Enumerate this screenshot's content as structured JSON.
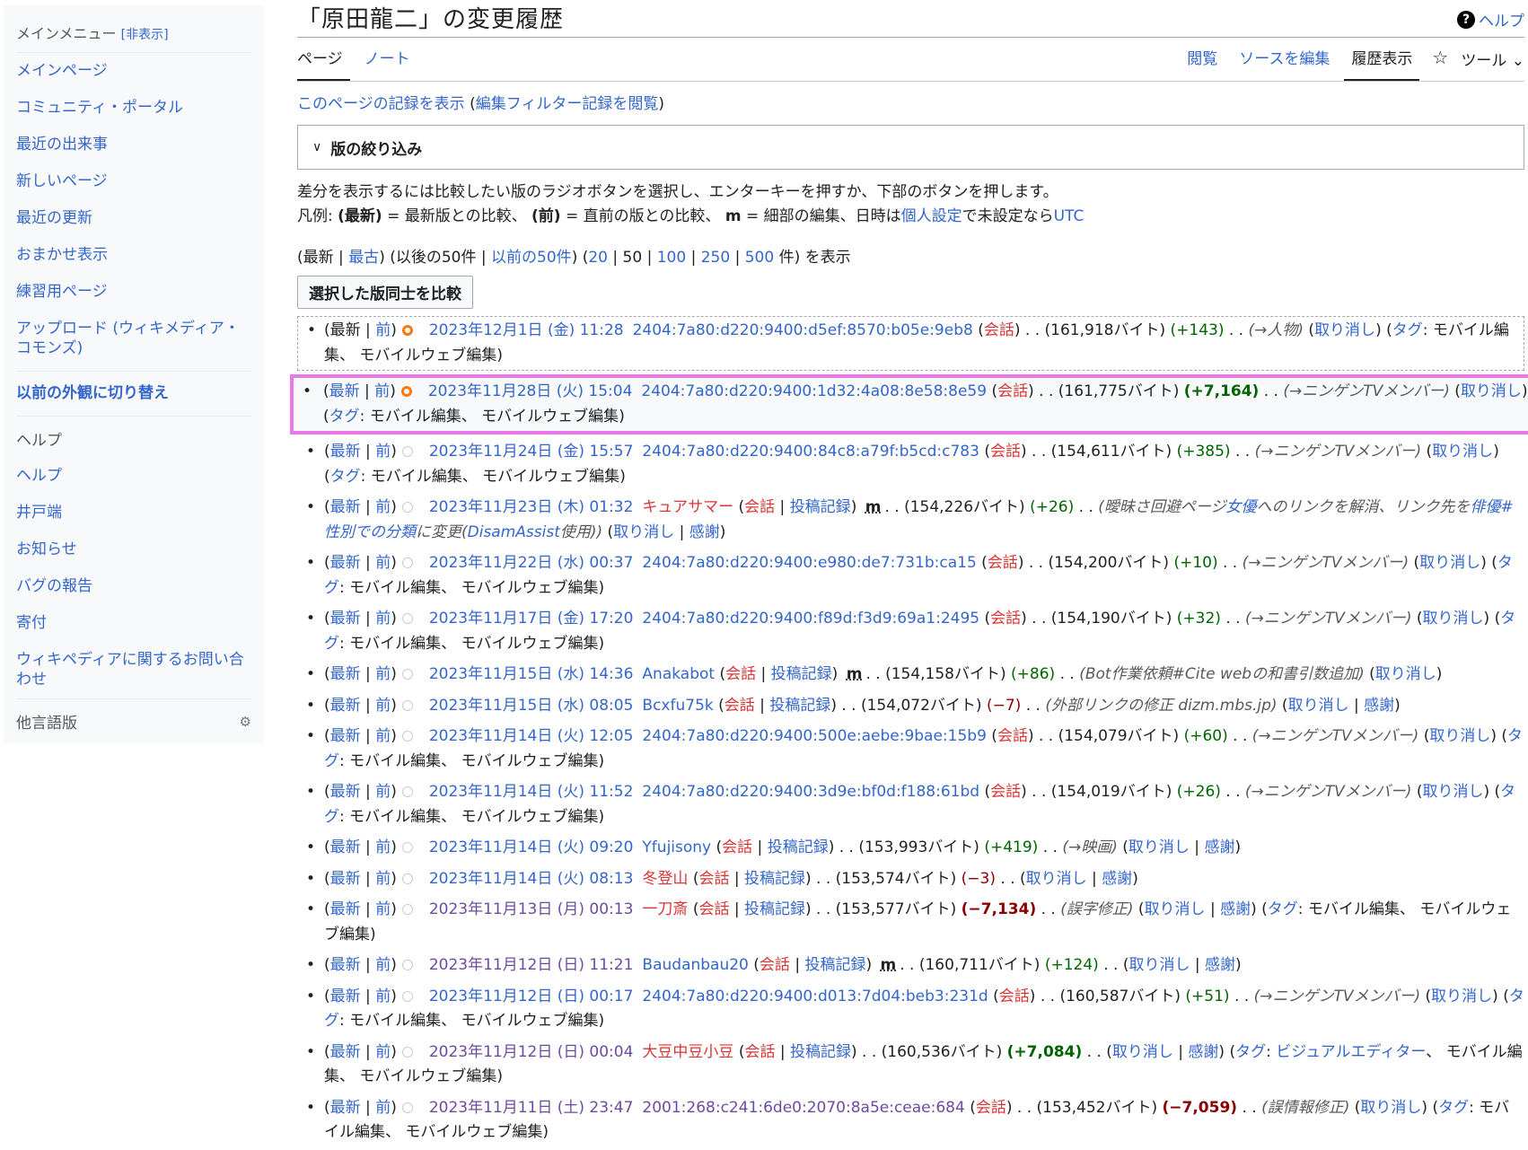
{
  "sidebar": {
    "menu_title": "メインメニュー",
    "hide_label": "[非表示]",
    "items": [
      "メインページ",
      "コミュニティ・ポータル",
      "最近の出来事",
      "新しいページ",
      "最近の更新",
      "おまかせ表示",
      "練習用ページ",
      "アップロード (ウィキメディア・コモンズ)"
    ],
    "switch_label": "以前の外観に切り替え",
    "help_heading": "ヘルプ",
    "help_items": [
      "ヘルプ",
      "井戸端",
      "お知らせ",
      "バグの報告",
      "寄付",
      "ウィキペディアに関するお問い合わせ"
    ],
    "lang_label": "他言語版"
  },
  "header": {
    "title": "「原田龍二」の変更履歴",
    "help": "ヘルプ"
  },
  "tabs": {
    "page": "ページ",
    "note": "ノート",
    "view": "閲覧",
    "edit_source": "ソースを編集",
    "history": "履歴表示",
    "tools": "ツール"
  },
  "subtitle": {
    "log_link": "このページの記録を表示",
    "filter_log_link": "編集フィルター記録を閲覧"
  },
  "filter_box": {
    "label": "版の絞り込み"
  },
  "explanation": {
    "line1": "差分を表示するには比較したい版のラジオボタンを選択し、エンターキーを押すか、下部のボタンを押します。",
    "legend_prefix": "凡例:",
    "cur_label": "(最新)",
    "cur_desc": "= 最新版との比較、",
    "prev_label": "(前)",
    "prev_desc": "= 直前の版との比較、",
    "minor_label": "m",
    "minor_desc": "= 細部の編集、日時は",
    "prefs_link": "個人設定",
    "tz_text": "で未設定なら",
    "utc_link": "UTC"
  },
  "nav": {
    "newest": "最新",
    "oldest": "最古",
    "next50": "以後の50件",
    "prev50": "以前の50件",
    "limits": [
      "20",
      "50",
      "100",
      "250",
      "500"
    ],
    "count_suffix": "件",
    "show": "を表示"
  },
  "compare_button": "選択した版同士を比較",
  "history": [
    {
      "cur": "最新",
      "prev": "前",
      "timestamp": "2023年12月1日 (金) 11:28",
      "user": "2404:7a80:d220:9400:d5ef:8570:b05e:9eb8",
      "talk": "会話",
      "size": "(161,918バイト)",
      "diff": "(+143)",
      "comment": "(→人物)",
      "undo": "取り消し",
      "tag_label": "タグ",
      "tags": "モバイル編集、 モバイルウェブ編集"
    },
    {
      "cur": "最新",
      "prev": "前",
      "timestamp": "2023年11月28日 (火) 15:04",
      "user": "2404:7a80:d220:9400:1d32:4a08:8e58:8e59",
      "talk": "会話",
      "size": "(161,775バイト)",
      "diff": "(+7,164)",
      "comment": "(→ニンゲンTVメンバー)",
      "undo": "取り消し",
      "tag_label": "タグ",
      "tags": "モバイル編集、 モバイルウェブ編集"
    },
    {
      "cur": "最新",
      "prev": "前",
      "timestamp": "2023年11月24日 (金) 15:57",
      "user": "2404:7a80:d220:9400:84c8:a79f:b5cd:c783",
      "talk": "会話",
      "size": "(154,611バイト)",
      "diff": "(+385)",
      "comment": "(→ニンゲンTVメンバー)",
      "undo": "取り消し",
      "tag_label": "タグ",
      "tags": "モバイル編集、 モバイルウェブ編集"
    },
    {
      "cur": "最新",
      "prev": "前",
      "timestamp": "2023年11月23日 (木) 01:32",
      "user": "キュアサマー",
      "talk": "会話",
      "contribs": "投稿記録",
      "minor": "m",
      "size": "(154,226バイト)",
      "diff": "(+26)",
      "comment_a": "(曖昧さ回避ページ",
      "comment_link1": "女優",
      "comment_b": "へのリンクを解消、リンク先を",
      "comment_link2": "俳優#性別での分類",
      "comment_c": "に変更(",
      "comment_link3": "DisamAssist",
      "comment_d": "使用))",
      "undo": "取り消し",
      "thanks": "感謝"
    },
    {
      "cur": "最新",
      "prev": "前",
      "timestamp": "2023年11月22日 (水) 00:37",
      "user": "2404:7a80:d220:9400:e980:de7:731b:ca15",
      "talk": "会話",
      "size": "(154,200バイト)",
      "diff": "(+10)",
      "comment": "(→ニンゲンTVメンバー)",
      "undo": "取り消し",
      "tag_label": "タグ",
      "tags": "モバイル編集、 モバイルウェブ編集"
    },
    {
      "cur": "最新",
      "prev": "前",
      "timestamp": "2023年11月17日 (金) 17:20",
      "user": "2404:7a80:d220:9400:f89d:f3d9:69a1:2495",
      "talk": "会話",
      "size": "(154,190バイト)",
      "diff": "(+32)",
      "comment": "(→ニンゲンTVメンバー)",
      "undo": "取り消し",
      "tag_label": "タグ",
      "tags": "モバイル編集、 モバイルウェブ編集"
    },
    {
      "cur": "最新",
      "prev": "前",
      "timestamp": "2023年11月15日 (水) 14:36",
      "user": "Anakabot",
      "talk": "会話",
      "contribs": "投稿記録",
      "minor": "m",
      "size": "(154,158バイト)",
      "diff": "(+86)",
      "comment": "(Bot作業依頼#Cite webの和書引数追加)",
      "undo": "取り消し"
    },
    {
      "cur": "最新",
      "prev": "前",
      "timestamp": "2023年11月15日 (水) 08:05",
      "user": "Bcxfu75k",
      "talk": "会話",
      "contribs": "投稿記録",
      "size": "(154,072バイト)",
      "diff": "(−7)",
      "comment": "(外部リンクの修正 dizm.mbs.jp)",
      "undo": "取り消し",
      "thanks": "感謝"
    },
    {
      "cur": "最新",
      "prev": "前",
      "timestamp": "2023年11月14日 (火) 12:05",
      "user": "2404:7a80:d220:9400:500e:aebe:9bae:15b9",
      "talk": "会話",
      "size": "(154,079バイト)",
      "diff": "(+60)",
      "comment": "(→ニンゲンTVメンバー)",
      "undo": "取り消し",
      "tag_label": "タグ",
      "tags": "モバイル編集、 モバイルウェブ編集"
    },
    {
      "cur": "最新",
      "prev": "前",
      "timestamp": "2023年11月14日 (火) 11:52",
      "user": "2404:7a80:d220:9400:3d9e:bf0d:f188:61bd",
      "talk": "会話",
      "size": "(154,019バイト)",
      "diff": "(+26)",
      "comment": "(→ニンゲンTVメンバー)",
      "undo": "取り消し",
      "tag_label": "タグ",
      "tags": "モバイル編集、 モバイルウェブ編集"
    },
    {
      "cur": "最新",
      "prev": "前",
      "timestamp": "2023年11月14日 (火) 09:20",
      "user": "Yfujisony",
      "talk": "会話",
      "contribs": "投稿記録",
      "size": "(153,993バイト)",
      "diff": "(+419)",
      "comment": "(→映画)",
      "undo": "取り消し",
      "thanks": "感謝"
    },
    {
      "cur": "最新",
      "prev": "前",
      "timestamp": "2023年11月14日 (火) 08:13",
      "user": "冬登山",
      "talk": "会話",
      "contribs": "投稿記録",
      "size": "(153,574バイト)",
      "diff": "(−3)",
      "undo": "取り消し",
      "thanks": "感謝"
    },
    {
      "cur": "最新",
      "prev": "前",
      "timestamp": "2023年11月13日 (月) 00:13",
      "user": "一刀斎",
      "talk": "会話",
      "contribs": "投稿記録",
      "size": "(153,577バイト)",
      "diff": "(−7,134)",
      "comment": "(誤字修正)",
      "undo": "取り消し",
      "thanks": "感謝",
      "tag_label": "タグ",
      "tags": "モバイル編集、 モバイルウェブ編集"
    },
    {
      "cur": "最新",
      "prev": "前",
      "timestamp": "2023年11月12日 (日) 11:21",
      "user": "Baudanbau20",
      "talk": "会話",
      "contribs": "投稿記録",
      "minor": "m",
      "size": "(160,711バイト)",
      "diff": "(+124)",
      "undo": "取り消し",
      "thanks": "感謝"
    },
    {
      "cur": "最新",
      "prev": "前",
      "timestamp": "2023年11月12日 (日) 00:17",
      "user": "2404:7a80:d220:9400:d013:7d04:beb3:231d",
      "talk": "会話",
      "size": "(160,587バイト)",
      "diff": "(+51)",
      "comment": "(→ニンゲンTVメンバー)",
      "undo": "取り消し",
      "tag_label": "タグ",
      "tags": "モバイル編集、 モバイルウェブ編集"
    },
    {
      "cur": "最新",
      "prev": "前",
      "timestamp": "2023年11月12日 (日) 00:04",
      "user": "大豆中豆小豆",
      "talk": "会話",
      "contribs": "投稿記録",
      "size": "(160,536バイト)",
      "diff": "(+7,084)",
      "undo": "取り消し",
      "thanks": "感謝",
      "tag_label": "タグ",
      "tag_link": "ビジュアルエディター",
      "tags": "、 モバイル編集、 モバイルウェブ編集"
    },
    {
      "cur": "最新",
      "prev": "前",
      "timestamp": "2023年11月11日 (土) 23:47",
      "user": "2001:268:c241:6de0:2070:8a5e:ceae:684",
      "talk": "会話",
      "size": "(153,452バイト)",
      "diff": "(−7,059)",
      "comment": "(誤情報修正)",
      "undo": "取り消し",
      "tag_label": "タグ",
      "tags": "モバイル編集、 モバイルウェブ編集"
    }
  ]
}
